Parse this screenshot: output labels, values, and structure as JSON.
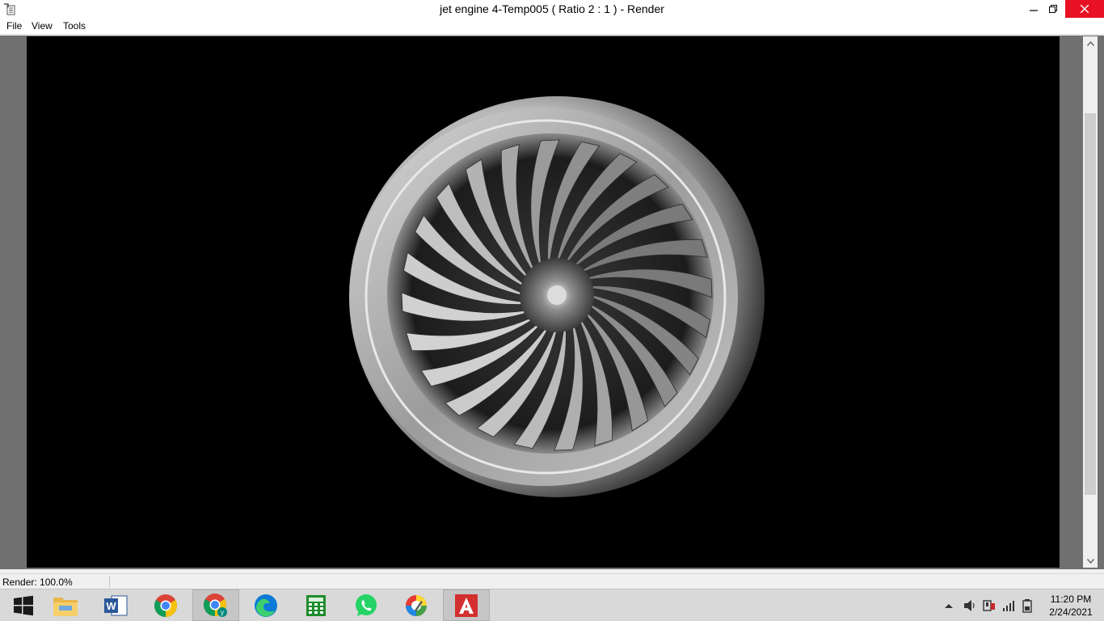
{
  "window": {
    "title": "jet engine 4-Temp005  ( Ratio 2 : 1 ) - Render",
    "app_icon": "render-window-icon",
    "controls": [
      "minimize-icon",
      "restore-icon",
      "close-icon"
    ]
  },
  "menu": {
    "file": "File",
    "view": "View",
    "tools": "Tools"
  },
  "viewport": {
    "content": "rendered jet engine fan (grayscale)",
    "background": "#000000"
  },
  "status": {
    "text": "Render: 100.0%"
  },
  "taskbar": {
    "apps": [
      {
        "name": "start-windows-icon"
      },
      {
        "name": "file-explorer-icon"
      },
      {
        "name": "word-icon"
      },
      {
        "name": "chrome-icon"
      },
      {
        "name": "chrome-profile-icon"
      },
      {
        "name": "edge-icon"
      },
      {
        "name": "calculator-icon"
      },
      {
        "name": "whatsapp-icon"
      },
      {
        "name": "color-picker-app-icon"
      },
      {
        "name": "autocad-icon"
      }
    ],
    "tray": [
      "chevron-up-icon",
      "volume-icon",
      "network-adapter-icon",
      "signal-bars-icon",
      "battery-icon"
    ],
    "clock_time": "11:20 PM",
    "clock_date": "2/24/2021"
  },
  "colors": {
    "close_button": "#e81123",
    "render_bg": "#000000",
    "frame": "#707070"
  }
}
